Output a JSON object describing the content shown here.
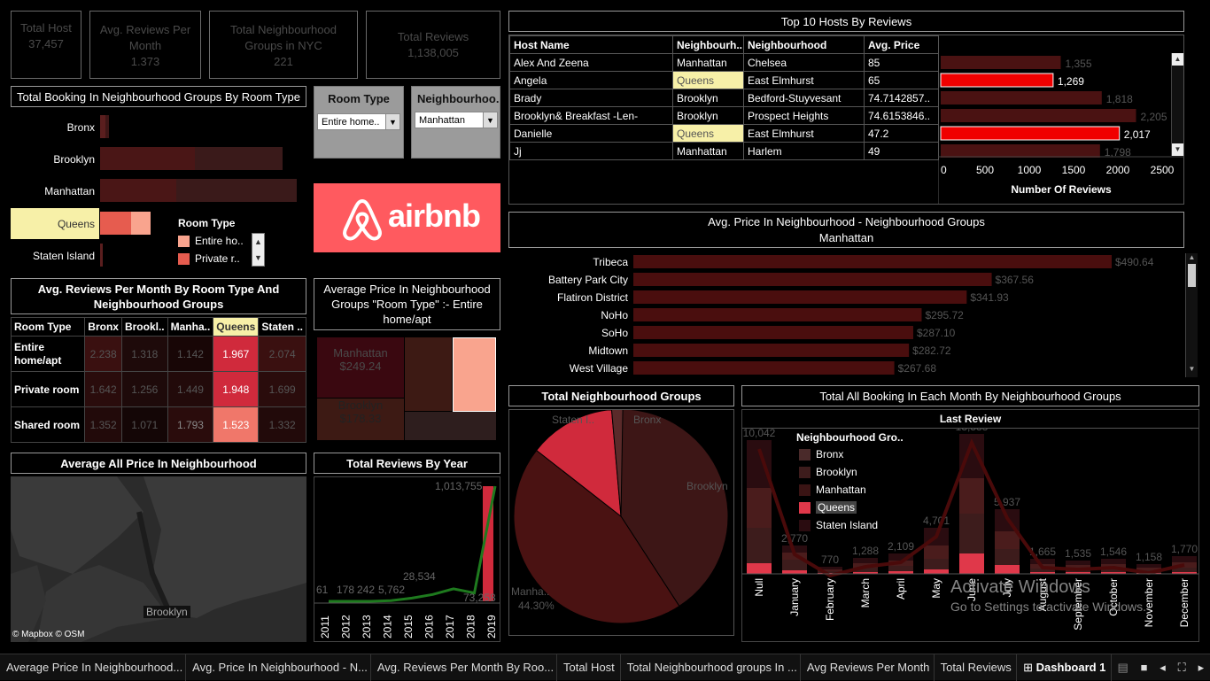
{
  "kpis": [
    {
      "title": "Total Host",
      "value": "37,457"
    },
    {
      "title": "Avg. Reviews Per Month",
      "value": "1.373"
    },
    {
      "title": "Total Neighbourhood Groups in NYC",
      "value": "221"
    },
    {
      "title": "Total Reviews",
      "value": "1,138,005"
    }
  ],
  "booking": {
    "title": "Total Booking In Neighbourhood Groups By Room Type",
    "groups": [
      "Bronx",
      "Brooklyn",
      "Manhattan",
      "Queens",
      "Staten Island"
    ],
    "highlight": "Queens",
    "legend_title": "Room Type",
    "legend": [
      "Entire ho..",
      "Private r.."
    ],
    "legend_colors": [
      "#f9a48e",
      "#e65c4f"
    ]
  },
  "filters": {
    "room_type_label": "Room Type",
    "room_type_value": "Entire home..",
    "neigh_label": "Neighbourhoo..",
    "neigh_value": "Manhattan"
  },
  "logo": {
    "text": "airbnb",
    "bg": "#ff5a5f"
  },
  "heatmap": {
    "title": "Avg. Reviews Per Month By Room Type And Neighbourhood Groups",
    "row_header": "Room Type",
    "cols": [
      "Bronx",
      "Brookl..",
      "Manha..",
      "Queens",
      "Staten .."
    ],
    "rows": [
      {
        "name": "Entire home/apt",
        "vals": [
          "2.238",
          "1.318",
          "1.142",
          "1.967",
          "2.074"
        ]
      },
      {
        "name": "Private room",
        "vals": [
          "1.642",
          "1.256",
          "1.449",
          "1.948",
          "1.699"
        ]
      },
      {
        "name": "Shared room",
        "vals": [
          "1.352",
          "1.071",
          "1.793",
          "1.523",
          "1.332"
        ]
      }
    ]
  },
  "treemap": {
    "title": "Average Price In Neighbourhood Groups \"Room Type\" :- Entire home/apt",
    "items": [
      {
        "name": "Manhattan",
        "value": "$249.24"
      },
      {
        "name": "Brooklyn",
        "value": "$178.33"
      }
    ]
  },
  "map": {
    "title": "Average  All Price In Neighbourhood",
    "label": "Brooklyn",
    "credit": "© Mapbox © OSM"
  },
  "reviews_year": {
    "title": "Total Reviews By Year"
  },
  "hosts": {
    "title": "Top 10 Hosts By Reviews",
    "headers": [
      "Host Name",
      "Neighbourh..",
      "Neighbourhood",
      "Avg. Price"
    ],
    "axis_title": "Number Of Reviews",
    "rows": [
      {
        "host": "Alex And Zeena",
        "group": "Manhattan",
        "neigh": "Chelsea",
        "price": "85",
        "reviews": 1355,
        "label": "1,355",
        "hl": false
      },
      {
        "host": "Angela",
        "group": "Queens",
        "neigh": "East Elmhurst",
        "price": "65",
        "reviews": 1269,
        "label": "1,269",
        "hl": true
      },
      {
        "host": "Brady",
        "group": "Brooklyn",
        "neigh": "Bedford-Stuyvesant",
        "price": "74.7142857..",
        "reviews": 1818,
        "label": "1,818",
        "hl": false
      },
      {
        "host": "Brooklyn&  Breakfast  -Len-",
        "group": "Brooklyn",
        "neigh": "Prospect Heights",
        "price": "74.6153846..",
        "reviews": 2205,
        "label": "2,205",
        "hl": false
      },
      {
        "host": "Danielle",
        "group": "Queens",
        "neigh": "East Elmhurst",
        "price": "47.2",
        "reviews": 2017,
        "label": "2,017",
        "hl": true
      },
      {
        "host": "Jj",
        "group": "Manhattan",
        "neigh": "Harlem",
        "price": "49",
        "reviews": 1798,
        "label": "1,798",
        "hl": false
      }
    ],
    "ticks": [
      "0",
      "500",
      "1000",
      "1500",
      "2000",
      "2500"
    ]
  },
  "avg_price": {
    "title": "Avg. Price In Neighbourhood - Neighbourhood Groups",
    "subtitle": "Manhattan",
    "rows": [
      {
        "name": "Tribeca",
        "value": 490.64,
        "label": "$490.64"
      },
      {
        "name": "Battery Park City",
        "value": 367.56,
        "label": "$367.56"
      },
      {
        "name": "Flatiron District",
        "value": 341.93,
        "label": "$341.93"
      },
      {
        "name": "NoHo",
        "value": 295.72,
        "label": "$295.72"
      },
      {
        "name": "SoHo",
        "value": 287.1,
        "label": "$287.10"
      },
      {
        "name": "Midtown",
        "value": 282.72,
        "label": "$282.72"
      },
      {
        "name": "West Village",
        "value": 267.68,
        "label": "$267.68"
      }
    ]
  },
  "pie": {
    "title": "Total Neighbourhood Groups",
    "labels": [
      "Staten I..",
      "Bronx",
      "Brooklyn",
      "Manha..",
      "44.30%"
    ]
  },
  "monthly": {
    "title": "Total All Booking In Each Month By Neighbourhood Groups",
    "subtitle": "Last Review",
    "legend_title": "Neighbourhood Gro..",
    "legend": [
      "Bronx",
      "Brooklyn",
      "Manhattan",
      "Queens",
      "Staten Island"
    ],
    "legend_colors": [
      "#4a2a2a",
      "#3d1c1c",
      "#3a1414",
      "#e0384a",
      "#2a0c10"
    ],
    "months": [
      "Null",
      "January",
      "February",
      "March",
      "April",
      "May",
      "June",
      "July",
      "August",
      "September",
      "October",
      "November",
      "December"
    ]
  },
  "watermark": {
    "line1": "Activate Windows",
    "line2": "Go to Settings to activate Windows."
  },
  "tabs": [
    "Average Price In Neighbourhood...",
    "Avg. Price In Neighbourhood - N...",
    "Avg. Reviews Per Month By Roo...",
    "Total Host",
    "Total Neighbourhood groups In ...",
    "Avg Reviews Per Month",
    "Total Reviews",
    "Dashboard 1"
  ]
}
